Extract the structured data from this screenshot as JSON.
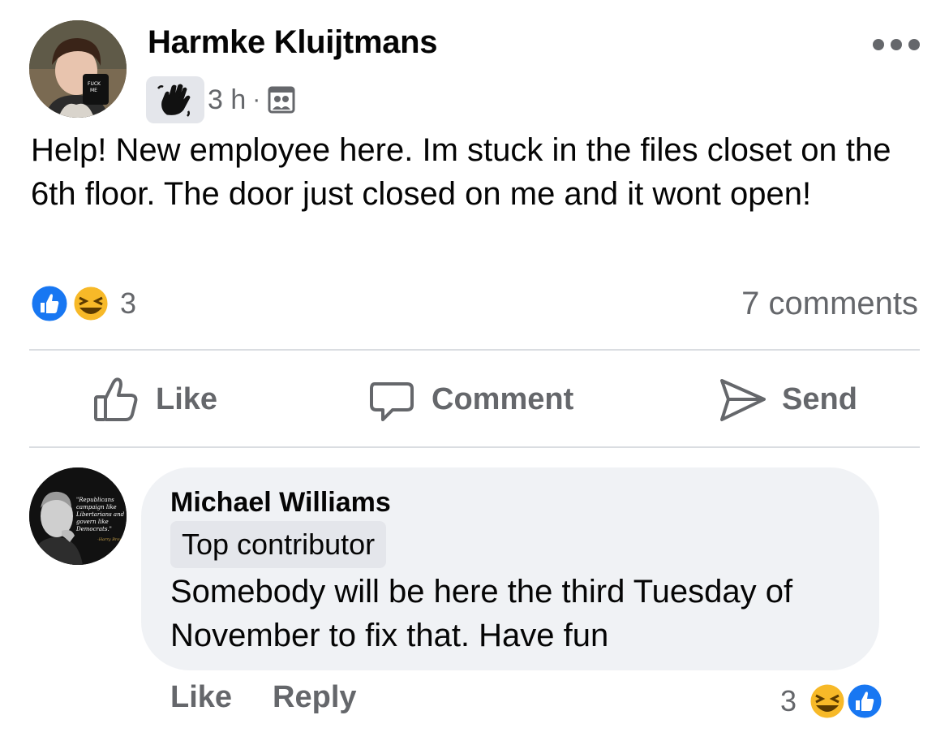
{
  "post": {
    "author": "Harmke Kluijtmans",
    "time": "3 h",
    "separator": "·",
    "badge_icon": "waving-hand-icon",
    "audience_icon": "group-members-icon",
    "text": "Help! New employee here. Im stuck in the files closet on the 6th floor. The door just closed on me and it wont open!",
    "reaction_count": "3",
    "reaction_icons": [
      "like-reaction-icon",
      "haha-reaction-icon"
    ],
    "comments_count": "7 comments"
  },
  "actions": {
    "like": "Like",
    "comment": "Comment",
    "send": "Send"
  },
  "comment": {
    "author": "Michael Williams",
    "badge": "Top contributor",
    "text": "Somebody will be here the third Tuesday of November to fix that. Have fun",
    "like": "Like",
    "reply": "Reply",
    "reaction_count": "3",
    "avatar_quote": "\"Republicans campaign like Libertarians and govern like Democrats.\" -Harry Browne"
  },
  "colors": {
    "secondary_text": "#65676b",
    "like_blue": "#1877f2",
    "haha_yellow": "#f7b928",
    "bubble_bg": "#f0f2f5"
  }
}
